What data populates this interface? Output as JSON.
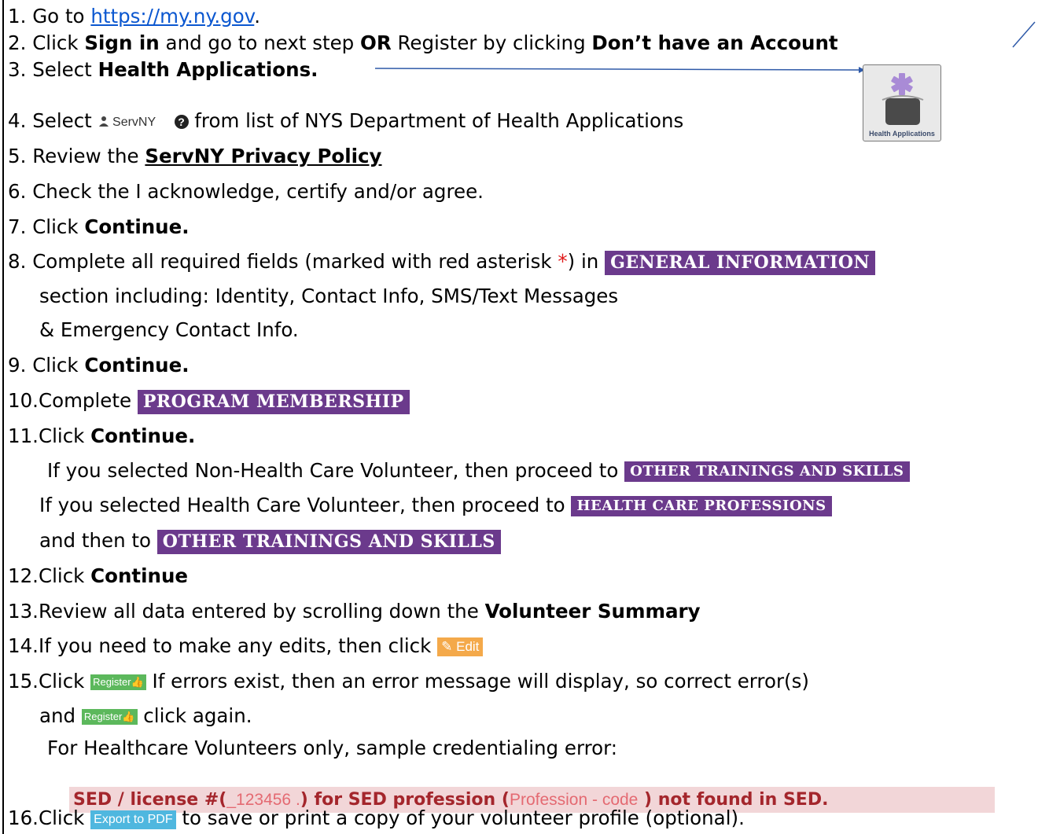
{
  "steps": [
    {
      "num": "1.",
      "pre": "Go to ",
      "link": "https://my.ny.gov",
      "post": "."
    },
    {
      "num": "2.",
      "a": "Click ",
      "b1": "Sign in",
      "c": " and go to next step ",
      "b2": "OR",
      "d": " Register by clicking ",
      "b3": "Don’t have an Account"
    },
    {
      "num": "3.",
      "a": "Select ",
      "b1": "Health Applications."
    },
    {
      "num": "4.",
      "a": "Select ",
      "servny": "ServNY",
      "help": "?",
      "c": " from list of NYS Department of Health Applications"
    },
    {
      "num": "5.",
      "a": "Review the ",
      "bu": "ServNY Privacy Policy"
    },
    {
      "num": "6.",
      "a": "Check the I acknowledge, certify and/or agree."
    },
    {
      "num": "7.",
      "a": "Click ",
      "b1": "Continue."
    },
    {
      "num": "8.",
      "a": "Complete all required fields (marked with red asterisk ",
      "ast": "*",
      "c": ") in ",
      "tag": "GENERAL INFORMATION",
      "cont1": "section including: Identity, Contact Info, SMS/Text Messages",
      "cont2": "& Emergency Contact Info."
    },
    {
      "num": "9.",
      "a": "Click ",
      "b1": "Continue."
    },
    {
      "num": "10.",
      "a": "Complete ",
      "tag": "PROGRAM MEMBERSHIP"
    },
    {
      "num": "11.",
      "a": "Click ",
      "b1": "Continue.",
      "sub1": "If you selected Non-Health Care Volunteer, then proceed to ",
      "tag1": "OTHER TRAININGS AND SKILLS",
      "sub2": "If you selected Health Care Volunteer, then proceed to ",
      "tag2": "HEALTH CARE PROFESSIONS",
      "sub3": "and then to ",
      "tag3": "OTHER TRAININGS AND SKILLS"
    },
    {
      "num": "12.",
      "a": "Click ",
      "b1": "Continue"
    },
    {
      "num": "13.",
      "a": "Review all data entered by scrolling down the ",
      "b1": "Volunteer Summary"
    },
    {
      "num": "14.",
      "a": "If you need to make any edits, then click ",
      "btn": "Edit",
      "btn_icon": "✎"
    },
    {
      "num": "15.",
      "a": "Click ",
      "btn": "Register",
      "btn_icon": "👍",
      "c": " If errors exist, then an error message will display, so correct error(s)",
      "cont_a": "and ",
      "cont_c": " click again.",
      "sub": "For Healthcare Volunteers only, sample credentialing error:",
      "err_a": "SED / license #(",
      "err_num": "_123456 .",
      "err_b": ") for SED profession (",
      "err_code": "Profession - code",
      "err_c": " ) not found in SED."
    },
    {
      "num": "16.",
      "a": "Click ",
      "btn": "Export to PDF",
      "c": " to save or print a copy of your volunteer profile (optional)."
    }
  ],
  "health_apps_icon": {
    "label": "Health Applications",
    "icon": "star-of-life"
  },
  "colors": {
    "tag_bg": "#6b3a8c",
    "edit_bg": "#f4a94a",
    "register_bg": "#5cb85c",
    "pdf_bg": "#4fb7df",
    "error_bg": "#f2d6d8",
    "link": "#0b57d0"
  }
}
